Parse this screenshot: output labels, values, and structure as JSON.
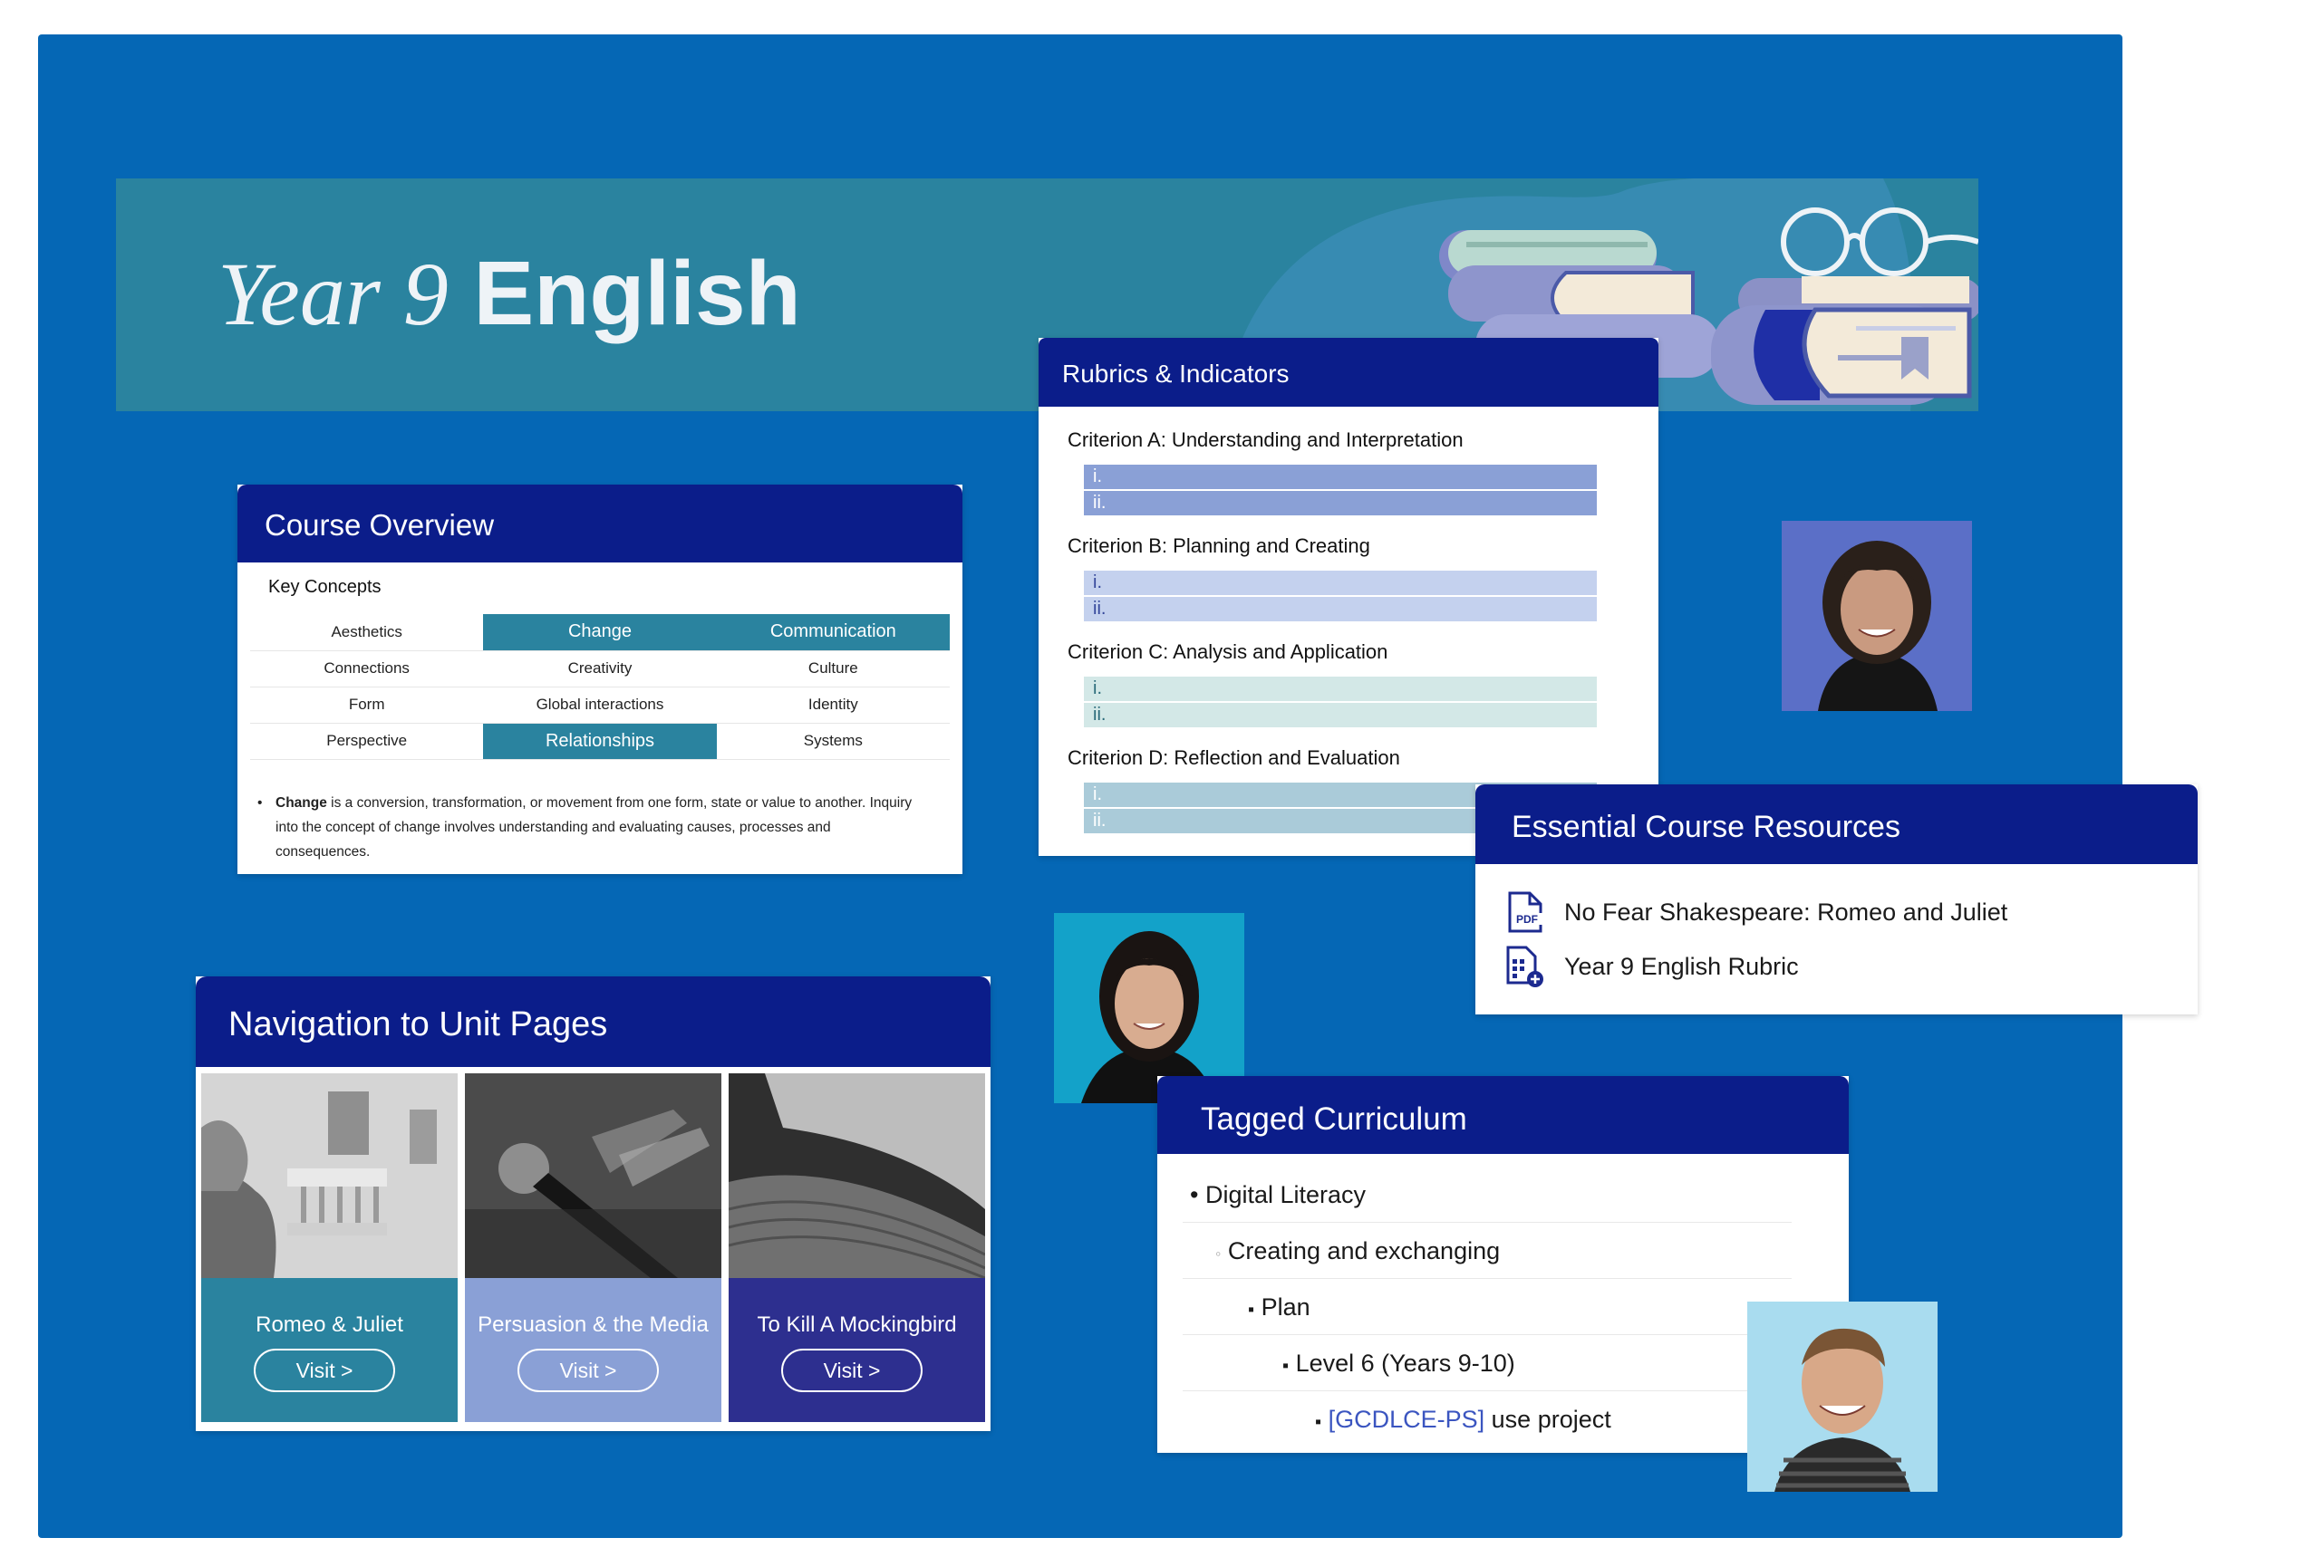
{
  "hero": {
    "title_year": "Year 9",
    "title_subject": "English"
  },
  "overview": {
    "heading": "Course Overview",
    "key_concepts_label": "Key Concepts",
    "table": [
      [
        {
          "t": "Aesthetics",
          "hl": false
        },
        {
          "t": "Change",
          "hl": true
        },
        {
          "t": "Communication",
          "hl": true
        }
      ],
      [
        {
          "t": "Connections",
          "hl": false
        },
        {
          "t": "Creativity",
          "hl": false
        },
        {
          "t": "Culture",
          "hl": false
        }
      ],
      [
        {
          "t": "Form",
          "hl": false
        },
        {
          "t": "Global interactions",
          "hl": false
        },
        {
          "t": "Identity",
          "hl": false
        }
      ],
      [
        {
          "t": "Perspective",
          "hl": false
        },
        {
          "t": "Relationships",
          "hl": true
        },
        {
          "t": "Systems",
          "hl": false
        }
      ]
    ],
    "note_term": "Change",
    "note_text": " is a conversion, transformation, or movement from one form, state or value to another. Inquiry into the concept of change involves understanding and evaluating causes, processes and consequences."
  },
  "rubrics": {
    "heading": "Rubrics & Indicators",
    "criteria": [
      {
        "label": "Criterion A: Understanding and Interpretation",
        "i": "i.",
        "ii": "ii."
      },
      {
        "label": "Criterion B:  Planning and Creating",
        "i": "i.",
        "ii": "ii."
      },
      {
        "label": "Criterion C: Analysis and Application",
        "i": "i.",
        "ii": "ii."
      },
      {
        "label": "Criterion D: Reflection and Evaluation",
        "i": "i.",
        "ii": "ii."
      }
    ]
  },
  "resources": {
    "heading": "Essential Course Resources",
    "items": [
      {
        "label": "No Fear Shakespeare: Romeo and Juliet",
        "icon": "pdf-file-icon"
      },
      {
        "label": "Year 9 English Rubric",
        "icon": "spreadsheet-file-icon"
      }
    ],
    "pdf_badge": "PDF"
  },
  "navigation": {
    "heading": "Navigation to Unit Pages",
    "tiles": [
      {
        "title": "Romeo & Juliet",
        "visit": "Visit >",
        "color": "#2a839f"
      },
      {
        "title": "Persuasion & the Media",
        "visit": "Visit >",
        "color": "#8aa0d6"
      },
      {
        "title": "To Kill A Mockingbird",
        "visit": "Visit >",
        "color": "#2d2f8f"
      }
    ]
  },
  "tagged": {
    "heading": "Tagged Curriculum",
    "rows": [
      {
        "bullet": "•",
        "text": "Digital Literacy"
      },
      {
        "bullet": "◦",
        "text": "Creating and exchanging"
      },
      {
        "bullet": "▪",
        "text": "Plan"
      },
      {
        "bullet": "▪",
        "text": "Level 6 (Years 9-10)"
      },
      {
        "bullet": "▪",
        "code": "[GCDLCE-PS]",
        "text": " use project"
      }
    ]
  },
  "colors": {
    "stage": "#0567b5",
    "header_navy": "#0b1d8a",
    "teal": "#2a839f",
    "periwinkle": "#8aa0d6"
  }
}
